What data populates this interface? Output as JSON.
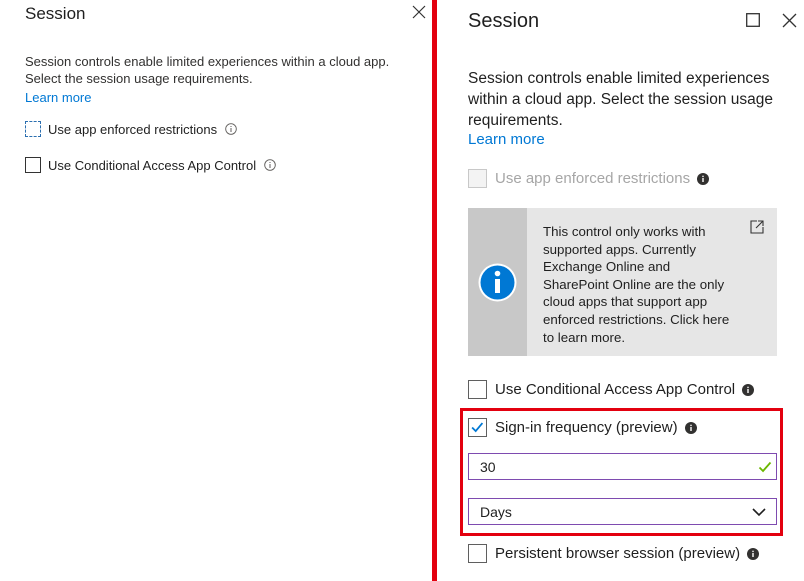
{
  "left_panel": {
    "title": "Session",
    "description": "Session controls enable limited experiences within a cloud app. Select the session usage requirements.",
    "learn_more": "Learn more",
    "options": [
      {
        "label": "Use app enforced restrictions",
        "checked": false
      },
      {
        "label": "Use Conditional Access App Control",
        "checked": false
      }
    ]
  },
  "right_panel": {
    "title": "Session",
    "description": "Session controls enable limited experiences within a cloud app. Select the session usage requirements.",
    "learn_more": "Learn more",
    "app_enforced": {
      "label": "Use app enforced restrictions",
      "checked": false,
      "disabled": true
    },
    "info_box": {
      "text": "This control only works with supported apps. Currently Exchange Online and SharePoint Online are the only cloud apps that support app enforced restrictions. Click here to learn more."
    },
    "app_control": {
      "label": "Use Conditional Access App Control",
      "checked": false
    },
    "sign_in_frequency": {
      "label": "Sign-in frequency (preview)",
      "checked": true,
      "value": "30",
      "unit": "Days"
    },
    "persistent_session": {
      "label": "Persistent browser session (preview)",
      "checked": false
    }
  },
  "colors": {
    "accent": "#0078d4",
    "highlight_red": "#e3000f",
    "field_border": "#7e4bb0",
    "valid_green": "#6bb700"
  }
}
